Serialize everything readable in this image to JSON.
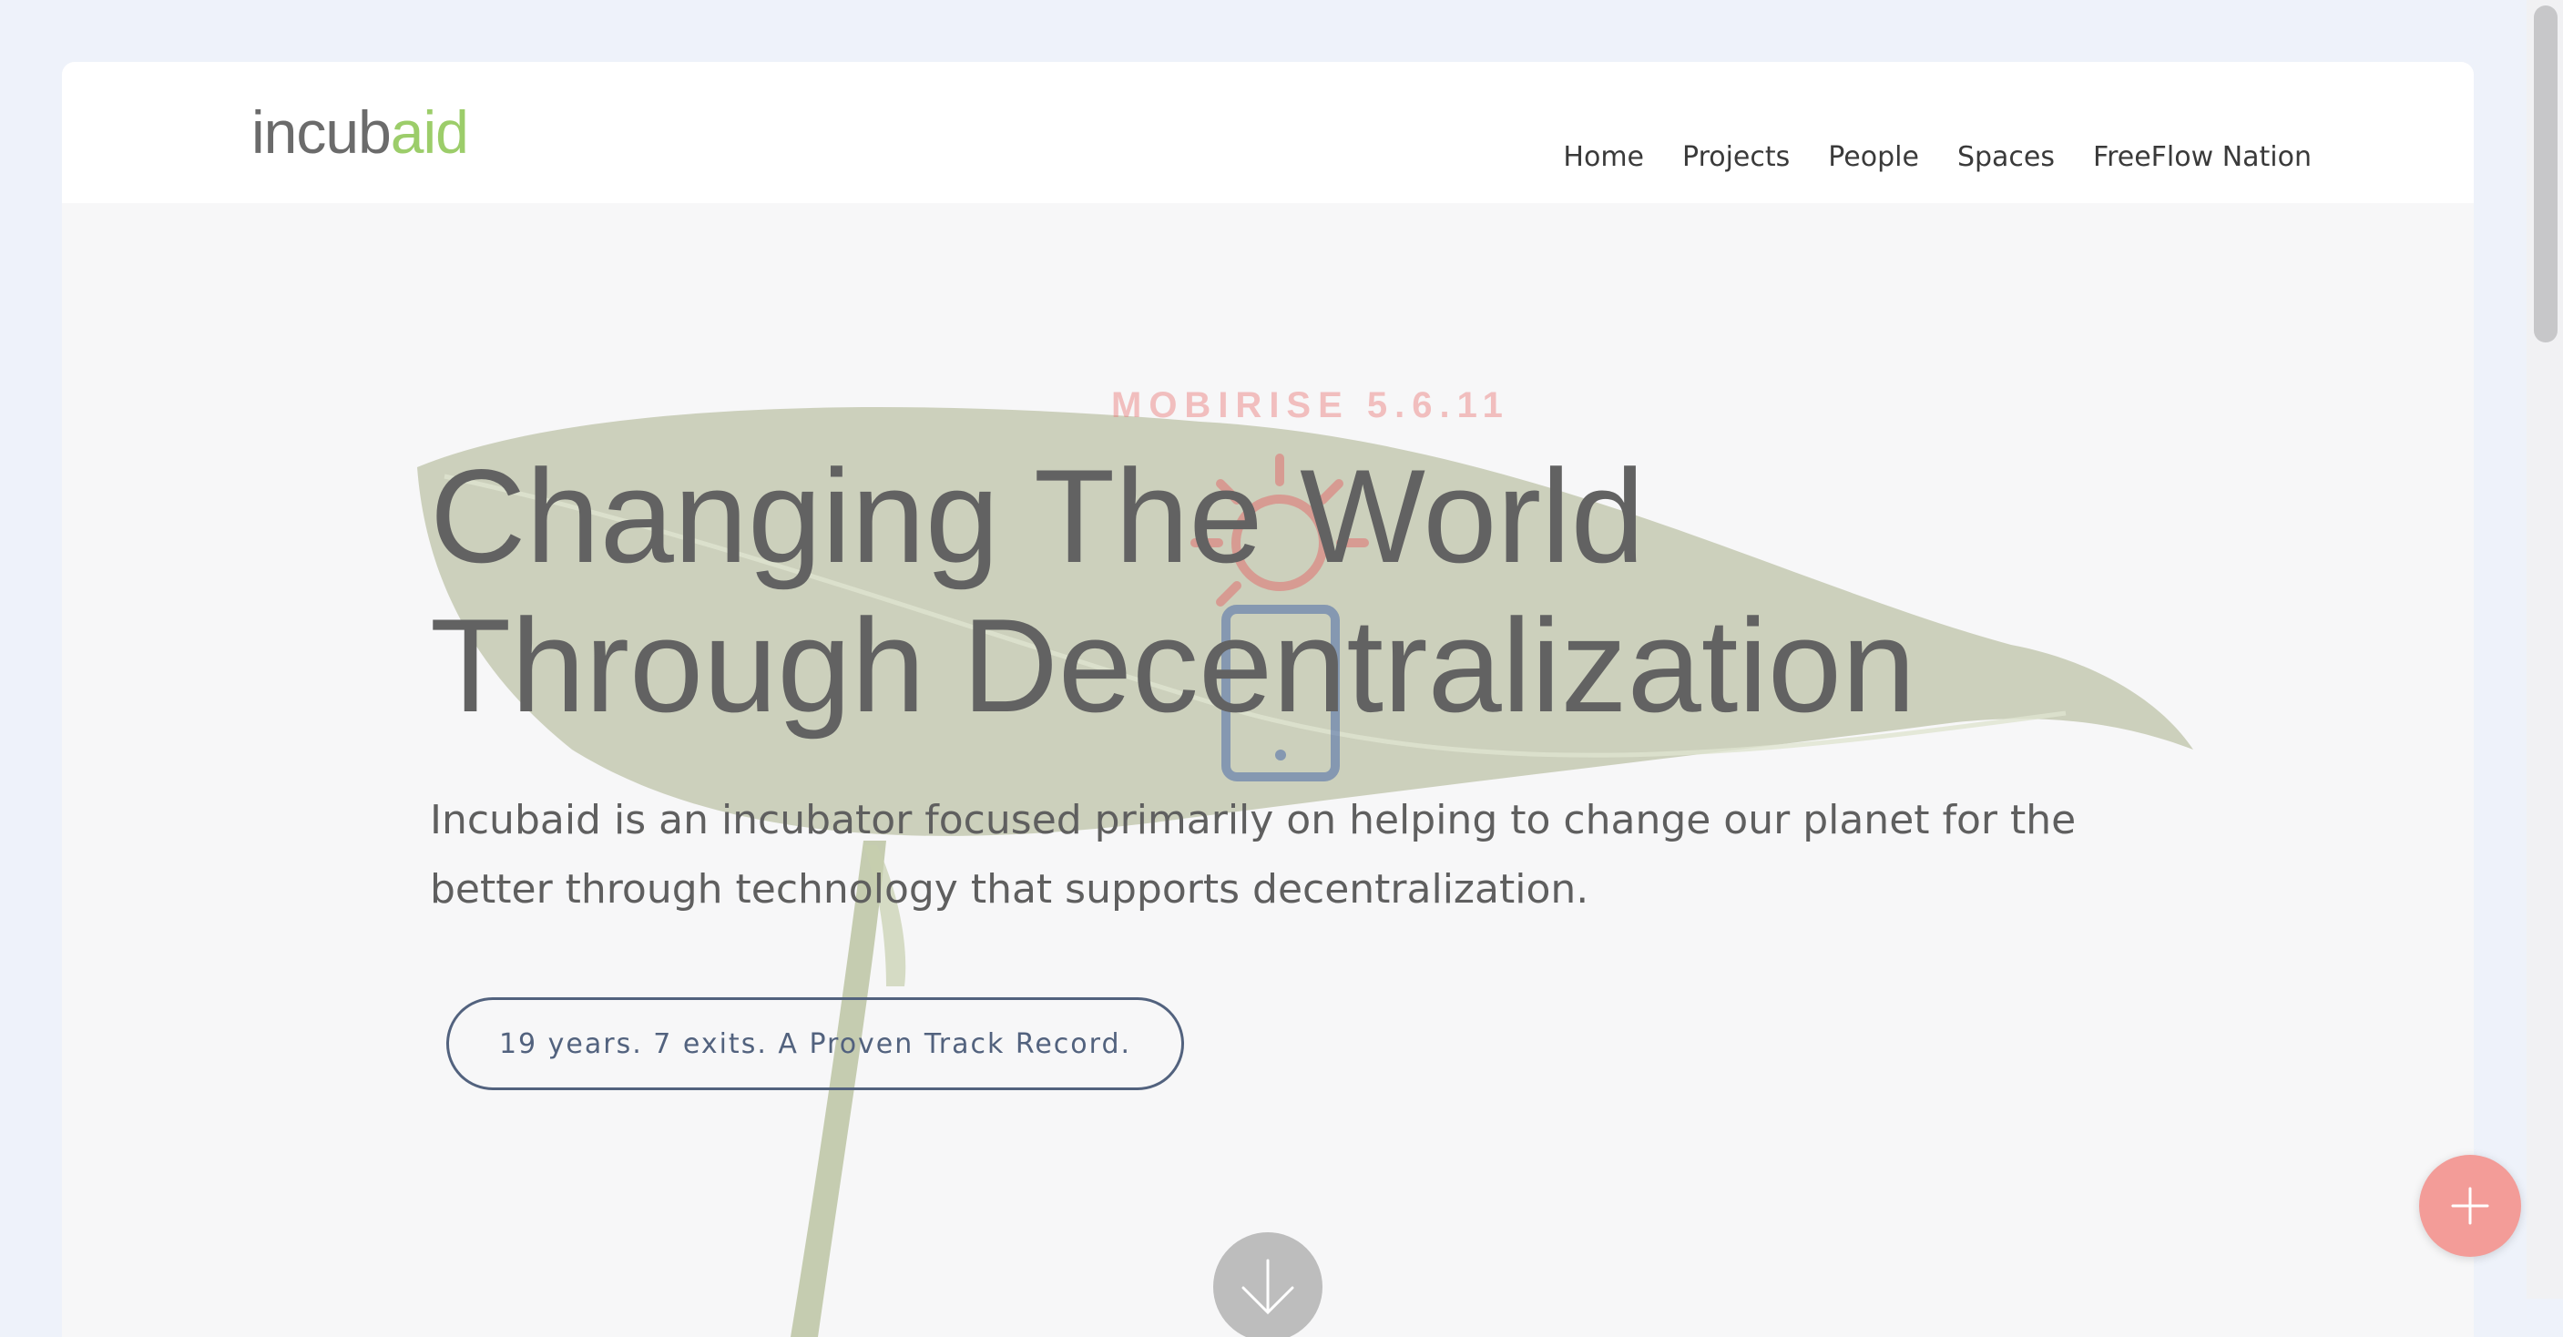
{
  "logo": {
    "part1": "incub",
    "part2": "aid"
  },
  "nav": {
    "items": [
      "Home",
      "Projects",
      "People",
      "Spaces",
      "FreeFlow Nation"
    ]
  },
  "watermark": {
    "text": "MOBIRISE 5.6.11"
  },
  "hero": {
    "title_line1": "Changing The World",
    "title_line2": "Through Decentralization",
    "subtitle": "Incubaid is an incubator focused primarily on helping to change our planet for the better through technology that supports decentralization.",
    "button_label": "19 years. 7 exits. A Proven Track Record."
  },
  "icons": {
    "scroll_down": "arrow-down-icon",
    "fab": "plus-icon",
    "overlay_sun": "sun-icon",
    "overlay_phone": "phone-icon"
  },
  "colors": {
    "logo_gray": "#6b6b6b",
    "logo_green": "#9ccd6a",
    "button_border": "#52627e",
    "fab": "#f39c98",
    "watermark": "#e87878"
  }
}
